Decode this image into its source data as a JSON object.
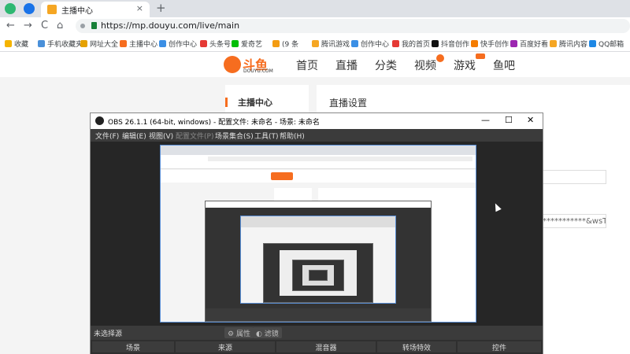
{
  "browser": {
    "tab_title": "主播中心",
    "tab_close": "×",
    "new_tab": "+",
    "url": "https://mp.douyu.com/live/main",
    "nav": {
      "back": "←",
      "forward": "→",
      "reload": "C",
      "home": "⌂"
    },
    "bookmarks": [
      "收藏",
      "手机收藏夹",
      "网址大全",
      "主播中心",
      "创作中心",
      "头条号",
      "爱奇艺",
      "(9 条",
      "腾讯游戏",
      "创作中心",
      "我的首页",
      "抖音创作",
      "快手创作",
      "百度好看",
      "腾讯内容",
      "QQ邮箱"
    ]
  },
  "douyu": {
    "logo_text": "斗鱼",
    "logo_sub": "DOUYU.COM",
    "nav": [
      "首页",
      "直播",
      "分类",
      "视频",
      "游戏",
      "鱼吧"
    ],
    "sidebar_title": "主播中心",
    "main_title": "直播设置",
    "field_value": "***********&wsTim"
  },
  "obs": {
    "title": "OBS 26.1.1 (64-bit, windows) - 配置文件: 未命名 - 场景: 未命名",
    "controls": {
      "min": "—",
      "max": "☐",
      "close": "✕"
    },
    "menu": [
      "文件(F)",
      "编辑(E)",
      "视图(V)",
      "配置文件(P)",
      "场景集合(S)",
      "工具(T)",
      "帮助(H)"
    ],
    "no_source": "未选择源",
    "properties": "属性",
    "filters": "滤镜",
    "docks": [
      "场景",
      "来源",
      "混音器",
      "转场特效",
      "控件"
    ]
  },
  "colors": {
    "accent": "#f66d1f",
    "obs_bg": "#2b2b2b",
    "selection": "#5a8fd6"
  }
}
